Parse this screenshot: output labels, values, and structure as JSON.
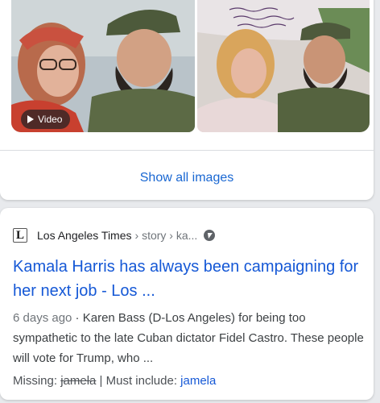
{
  "images": {
    "video_label": "Video",
    "show_all_label": "Show all images"
  },
  "result": {
    "site_name": "Los Angeles Times",
    "favicon_letter": "L",
    "breadcrumb": "› story › ka...",
    "title": "Kamala Harris has always been campaigning for her next job - Los ...",
    "date": "6 days ago",
    "separator": " · ",
    "snippet": "Karen Bass (D-Los Angeles) for being too sympathetic to the late Cuban dictator Fidel Castro. These people will vote for Trump, who ...",
    "missing_label": "Missing:",
    "missing_term": "jamela",
    "pipe": " | ",
    "must_include_label": "Must include:",
    "must_include_term": "jamela"
  },
  "colors": {
    "link_blue": "#1558d6",
    "text_gray": "#70757a"
  }
}
